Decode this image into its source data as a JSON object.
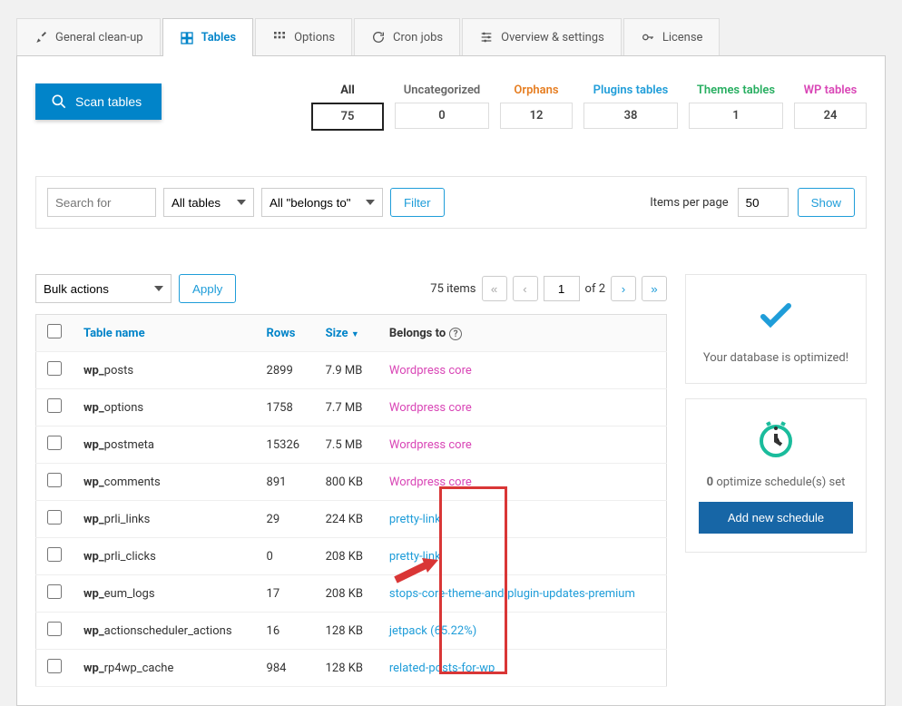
{
  "tabs": [
    {
      "label": "General clean-up"
    },
    {
      "label": "Tables"
    },
    {
      "label": "Options"
    },
    {
      "label": "Cron jobs"
    },
    {
      "label": "Overview & settings"
    },
    {
      "label": "License"
    }
  ],
  "scan_button": "Scan tables",
  "filter_tabs": {
    "all": {
      "label": "All",
      "count": "75"
    },
    "uncat": {
      "label": "Uncategorized",
      "count": "0"
    },
    "orphans": {
      "label": "Orphans",
      "count": "12"
    },
    "plugins": {
      "label": "Plugins tables",
      "count": "38"
    },
    "themes": {
      "label": "Themes tables",
      "count": "1"
    },
    "wp": {
      "label": "WP tables",
      "count": "24"
    }
  },
  "search": {
    "placeholder": "Search for",
    "tables_sel": "All tables",
    "belongs_sel": "All \"belongs to\"",
    "filter_btn": "Filter",
    "items_per_page_label": "Items per page",
    "items_per_page_value": "50",
    "show_btn": "Show"
  },
  "bulk": {
    "sel": "Bulk actions",
    "apply": "Apply"
  },
  "pager": {
    "total_items": "75 items",
    "page": "1",
    "of": "of 2"
  },
  "columns": {
    "name": "Table name",
    "rows": "Rows",
    "size": "Size",
    "belongs": "Belongs to"
  },
  "rows": [
    {
      "prefix": "wp_",
      "suffix": "posts",
      "rows": "2899",
      "size": "7.9 MB",
      "belongs": "Wordpress core",
      "type": "core"
    },
    {
      "prefix": "wp_",
      "suffix": "options",
      "rows": "1758",
      "size": "7.7 MB",
      "belongs": "Wordpress core",
      "type": "core"
    },
    {
      "prefix": "wp_",
      "suffix": "postmeta",
      "rows": "15326",
      "size": "7.5 MB",
      "belongs": "Wordpress core",
      "type": "core"
    },
    {
      "prefix": "wp_",
      "suffix": "comments",
      "rows": "891",
      "size": "800 KB",
      "belongs": "Wordpress core",
      "type": "core"
    },
    {
      "prefix": "wp_",
      "suffix": "prli_links",
      "rows": "29",
      "size": "224 KB",
      "belongs": "pretty-link",
      "type": "plugin"
    },
    {
      "prefix": "wp_",
      "suffix": "prli_clicks",
      "rows": "0",
      "size": "208 KB",
      "belongs": "pretty-link",
      "type": "plugin"
    },
    {
      "prefix": "wp_",
      "suffix": "eum_logs",
      "rows": "17",
      "size": "208 KB",
      "belongs": "stops-core-theme-and-plugin-updates-premium",
      "type": "plugin"
    },
    {
      "prefix": "wp_",
      "suffix": "actionscheduler_actions",
      "rows": "16",
      "size": "128 KB",
      "belongs": "jetpack (65.22%)",
      "type": "plugin"
    },
    {
      "prefix": "wp_",
      "suffix": "rp4wp_cache",
      "rows": "984",
      "size": "128 KB",
      "belongs": "related-posts-for-wp",
      "type": "plugin"
    }
  ],
  "side": {
    "optimized": "Your database is optimized!",
    "schedule_count": "0",
    "schedule_text": " optimize schedule(s) set",
    "add_schedule": "Add new schedule"
  }
}
